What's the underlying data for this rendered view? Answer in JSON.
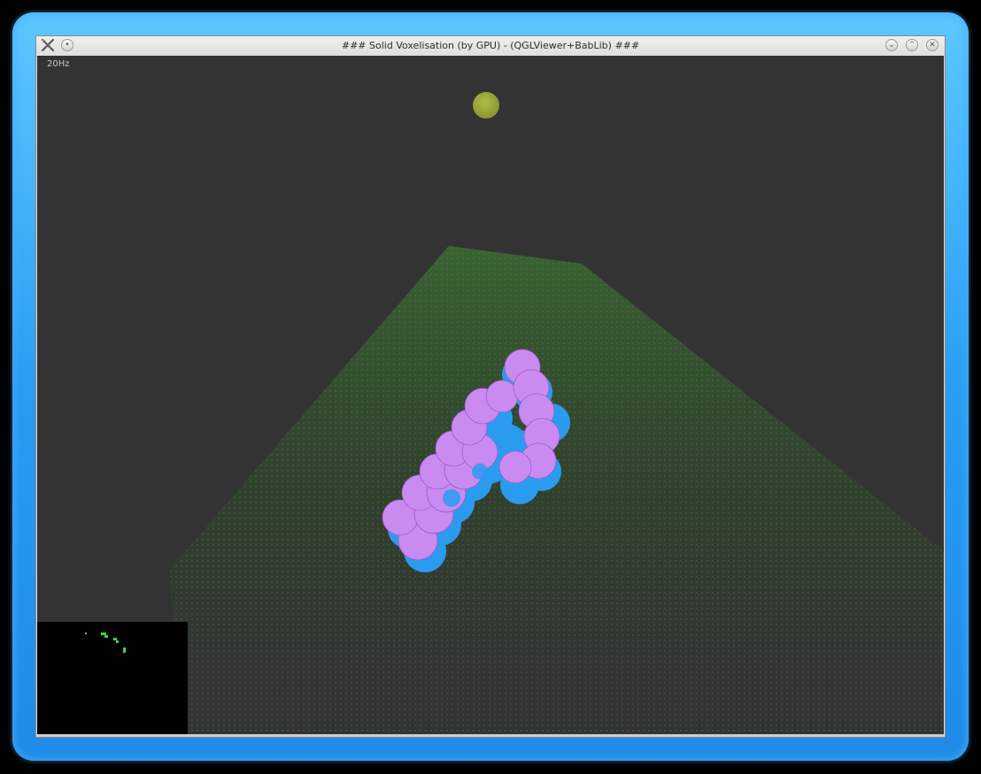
{
  "window": {
    "title": "### Solid Voxelisation (by GPU) - (QGLViewer+BabLib) ###",
    "buttons": {
      "menu_icon": "app-menu-icon",
      "sticky_icon": "sticky-dot-icon",
      "minimize_icon": "chevron-down-icon",
      "maximize_icon": "chevron-up-icon",
      "close_icon": "close-icon"
    }
  },
  "viewport": {
    "fps_label": "20Hz",
    "background_color": "#333333",
    "light_color": "#9aa63a",
    "voxel_top_color": "#c98bf0",
    "voxel_side_color": "#2a9cf0",
    "grid_color": "#3a7a2e"
  },
  "minimap": {
    "background_color": "#000000",
    "point_color": "#3ad63a"
  },
  "colors": {
    "frame_glow": "#2b9cf2"
  }
}
